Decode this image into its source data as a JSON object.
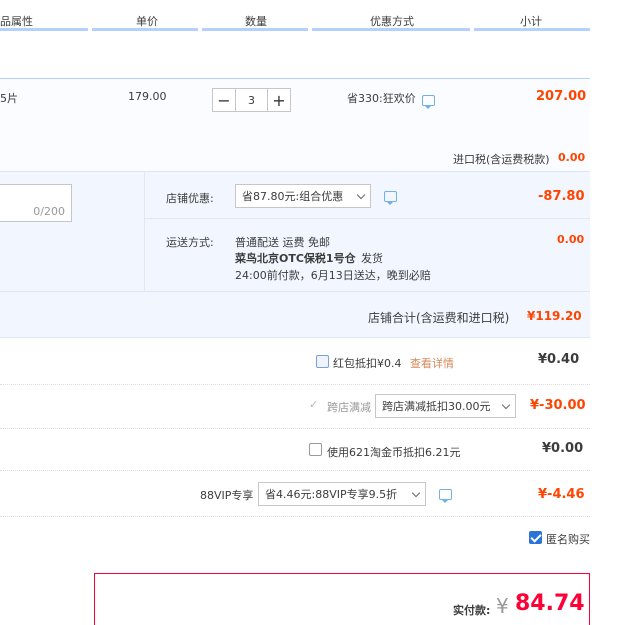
{
  "header": {
    "col_attrs": "品属性",
    "col_price": "单价",
    "col_qty": "数量",
    "col_discount": "优惠方式",
    "col_subtotal": "小计"
  },
  "item": {
    "attr": "5片",
    "price": "179.00",
    "qty": "3",
    "minus": "−",
    "plus": "+",
    "discount": "省330:狂欢价",
    "subtotal": "207.00"
  },
  "import_tax": {
    "label": "进口税(含运费税款)",
    "value": "0.00"
  },
  "message": {
    "counter": "0/200"
  },
  "shop_discount": {
    "label": "店铺优惠:",
    "selected": "省87.80元:组合优惠",
    "value": "-87.80"
  },
  "shipping": {
    "label": "运送方式:",
    "line1": "普通配送 运费 免邮",
    "line2_bold": "菜鸟北京OTC保税1号仓",
    "line2_rest": "发货",
    "line3": "24:00前付款，6月13日送达，晚到必赔",
    "value": "0.00"
  },
  "shop_total": {
    "label": "店铺合计(含运费和进口税)",
    "value": "¥119.20"
  },
  "redpacket": {
    "label": "红包抵扣¥0.4",
    "link": "查看详情",
    "value": "¥0.40"
  },
  "cross_store": {
    "label": "跨店满减",
    "selected": "跨店满减抵扣30.00元",
    "value": "¥-30.00"
  },
  "taojinbi": {
    "label": "使用621淘金币抵扣6.21元",
    "value": "¥0.00"
  },
  "vip": {
    "label": "88VIP专享",
    "selected": "省4.46元:88VIP专享9.5折",
    "value": "¥-4.46"
  },
  "anonymous": {
    "label": "匿名购买"
  },
  "pay": {
    "label": "实付款:",
    "currency": "¥",
    "value": "84.74"
  },
  "colors": {
    "accent_red": "#ff0036",
    "price_red": "#f40",
    "blue_line": "#b2d1ff"
  }
}
